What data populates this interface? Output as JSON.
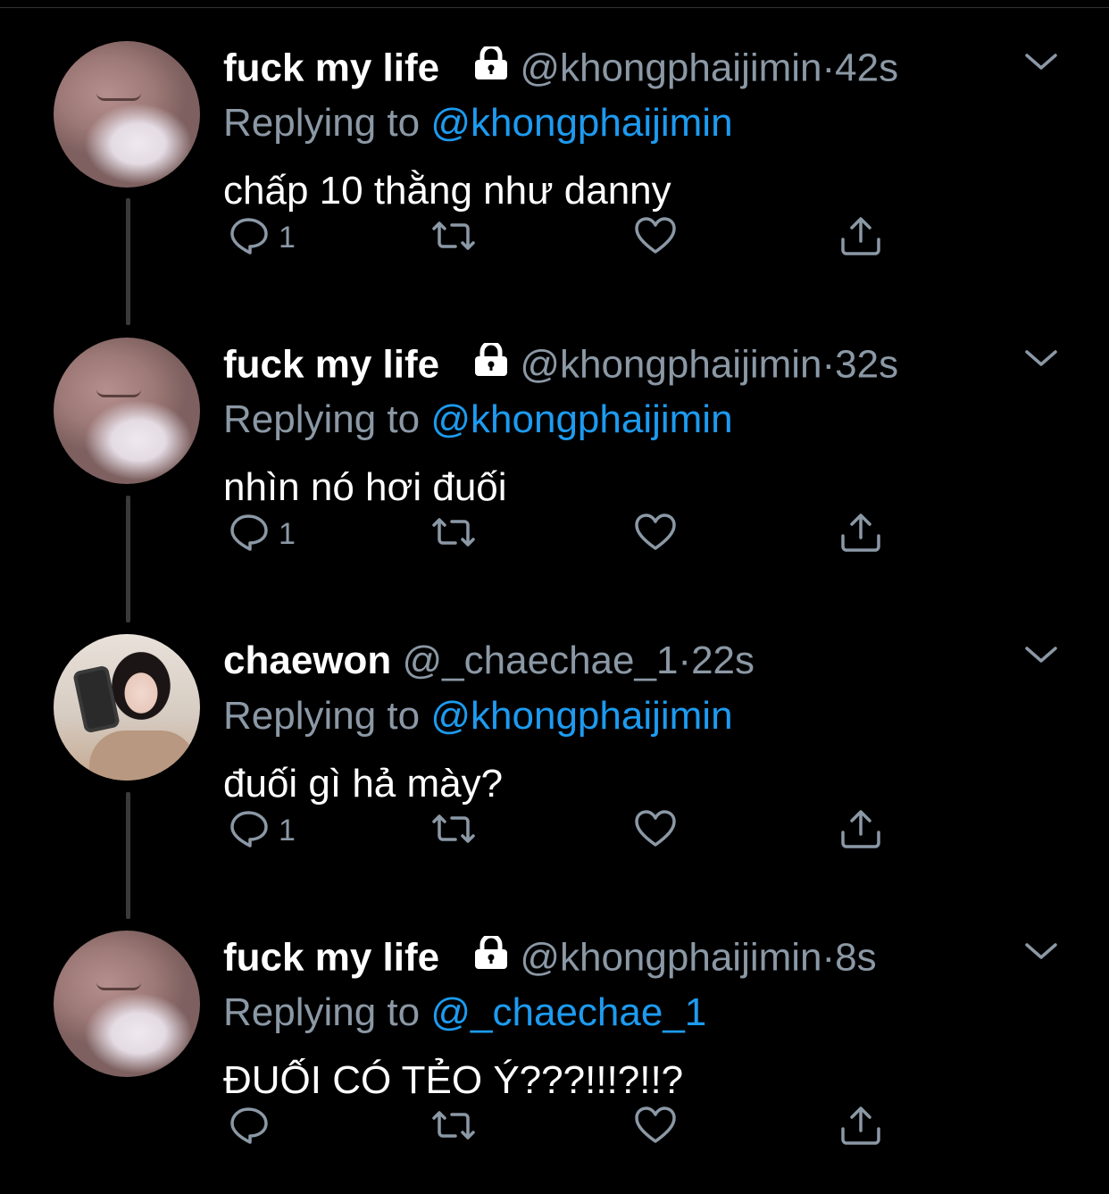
{
  "tweets": [
    {
      "name": "fuck my life",
      "locked": true,
      "handle": "@khongphaijimin",
      "time": "42s",
      "replying_prefix": "Replying to ",
      "replying_to": "@khongphaijimin",
      "text": "chấp 10 thằng như danny",
      "reply_count": "1",
      "avatar_icon": "avatar-face"
    },
    {
      "name": "fuck my life",
      "locked": true,
      "handle": "@khongphaijimin",
      "time": "32s",
      "replying_prefix": "Replying to ",
      "replying_to": "@khongphaijimin",
      "text": "nhìn nó hơi đuối",
      "reply_count": "1",
      "avatar_icon": "avatar-face"
    },
    {
      "name": "chaewon",
      "locked": false,
      "handle": "@_chaechae_1",
      "time": "22s",
      "replying_prefix": "Replying to ",
      "replying_to": "@khongphaijimin",
      "text": "đuối gì hả mày?",
      "reply_count": "1",
      "avatar_icon": "avatar-girl"
    },
    {
      "name": "fuck my life",
      "locked": true,
      "handle": "@khongphaijimin",
      "time": "8s",
      "replying_prefix": "Replying to ",
      "replying_to": "@_chaechae_1",
      "text": "ĐUỐI CÓ TẺO Ý???!!!?!!?",
      "reply_count": "",
      "avatar_icon": "avatar-face"
    }
  ],
  "dot": "·",
  "colors": {
    "background": "#000000",
    "muted": "#8b98a5",
    "link": "#1d9bf0",
    "thread": "#3a3a3a"
  }
}
